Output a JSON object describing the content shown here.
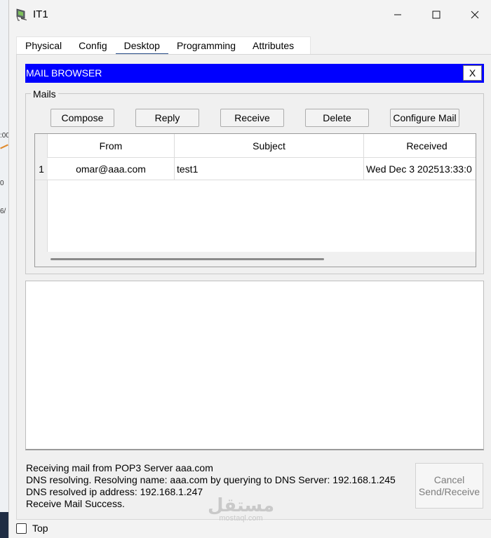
{
  "window": {
    "title": "IT1"
  },
  "tabs": [
    {
      "label": "Physical",
      "active": false
    },
    {
      "label": "Config",
      "active": false
    },
    {
      "label": "Desktop",
      "active": true
    },
    {
      "label": "Programming",
      "active": false
    },
    {
      "label": "Attributes",
      "active": false
    }
  ],
  "mail_browser": {
    "title": "MAIL BROWSER",
    "close_label": "X",
    "bar_color": "#0000ff",
    "mails_group_label": "Mails",
    "buttons": {
      "compose": "Compose",
      "reply": "Reply",
      "receive": "Receive",
      "delete": "Delete",
      "configure": "Configure Mail"
    },
    "table": {
      "headers": {
        "from": "From",
        "subject": "Subject",
        "received": "Received"
      },
      "rows": [
        {
          "num": "1",
          "from": "omar@aaa.com",
          "subject": "test1",
          "received": "Wed Dec 3 202513:33:0"
        }
      ]
    },
    "status_lines": [
      "Receiving mail from POP3 Server aaa.com",
      "DNS resolving. Resolving name: aaa.com by querying to DNS Server: 192.168.1.245",
      "DNS resolved ip address: 192.168.1.247",
      "Receive Mail Success."
    ],
    "cancel_button": {
      "line1": "Cancel",
      "line2": "Send/Receive"
    }
  },
  "top_checkbox": {
    "label": "Top",
    "checked": false
  },
  "background_fragments": [
    ":00",
    "0",
    "6/"
  ],
  "watermark": {
    "arabic": "مستقل",
    "latin": "mostaql.com"
  }
}
